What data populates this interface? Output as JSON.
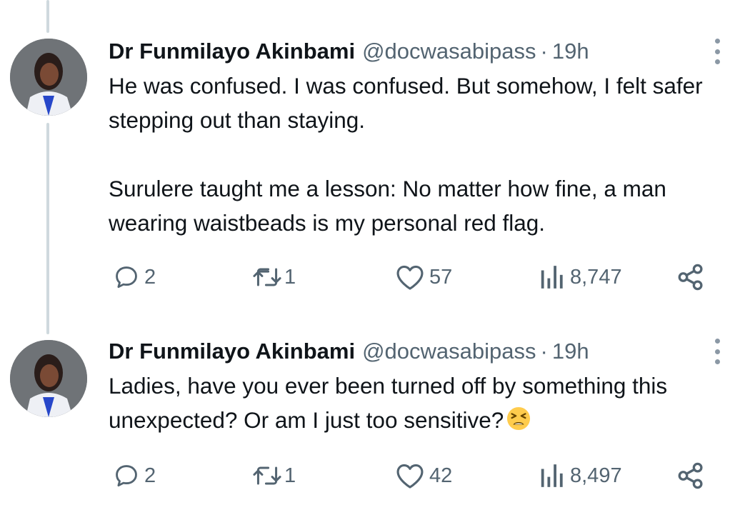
{
  "tweets": [
    {
      "author_name": "Dr Funmilayo Akinbami",
      "handle": "@docwasabipass",
      "separator": "·",
      "time": "19h",
      "paragraphs": [
        "He was confused. I was confused. But somehow, I felt safer stepping out than staying.",
        "Surulere taught me a lesson: No matter how fine, a man wearing waistbeads is my personal red flag."
      ],
      "replies": "2",
      "reposts": "1",
      "likes": "57",
      "views": "8,747"
    },
    {
      "author_name": "Dr Funmilayo Akinbami",
      "handle": "@docwasabipass",
      "separator": "·",
      "time": "19h",
      "text": "Ladies, have you ever been turned off by something this unexpected? Or am I just too sensitive?",
      "emoji": "tired-face-emoji",
      "replies": "2",
      "reposts": "1",
      "likes": "42",
      "views": "8,497"
    }
  ],
  "icons": {
    "reply": "comment-icon",
    "repost": "retweet-icon",
    "like": "heart-icon",
    "views": "analytics-icon",
    "share": "share-icon",
    "more": "more-options-icon"
  },
  "colors": {
    "text": "#0f1419",
    "secondary": "#536471",
    "thread_line": "#cfd9de"
  }
}
